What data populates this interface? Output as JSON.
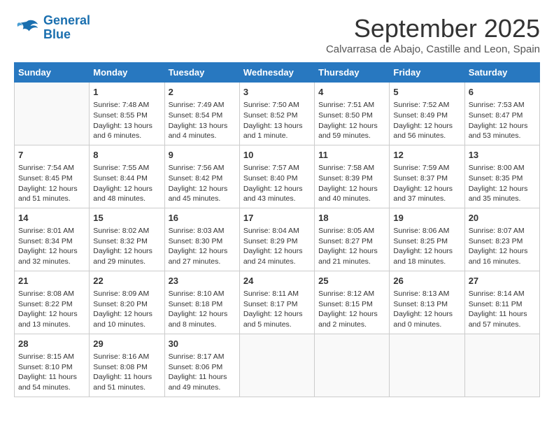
{
  "logo": {
    "line1": "General",
    "line2": "Blue"
  },
  "title": "September 2025",
  "subtitle": "Calvarrasa de Abajo, Castille and Leon, Spain",
  "weekdays": [
    "Sunday",
    "Monday",
    "Tuesday",
    "Wednesday",
    "Thursday",
    "Friday",
    "Saturday"
  ],
  "weeks": [
    [
      {
        "day": "",
        "info": ""
      },
      {
        "day": "1",
        "info": "Sunrise: 7:48 AM\nSunset: 8:55 PM\nDaylight: 13 hours\nand 6 minutes."
      },
      {
        "day": "2",
        "info": "Sunrise: 7:49 AM\nSunset: 8:54 PM\nDaylight: 13 hours\nand 4 minutes."
      },
      {
        "day": "3",
        "info": "Sunrise: 7:50 AM\nSunset: 8:52 PM\nDaylight: 13 hours\nand 1 minute."
      },
      {
        "day": "4",
        "info": "Sunrise: 7:51 AM\nSunset: 8:50 PM\nDaylight: 12 hours\nand 59 minutes."
      },
      {
        "day": "5",
        "info": "Sunrise: 7:52 AM\nSunset: 8:49 PM\nDaylight: 12 hours\nand 56 minutes."
      },
      {
        "day": "6",
        "info": "Sunrise: 7:53 AM\nSunset: 8:47 PM\nDaylight: 12 hours\nand 53 minutes."
      }
    ],
    [
      {
        "day": "7",
        "info": "Sunrise: 7:54 AM\nSunset: 8:45 PM\nDaylight: 12 hours\nand 51 minutes."
      },
      {
        "day": "8",
        "info": "Sunrise: 7:55 AM\nSunset: 8:44 PM\nDaylight: 12 hours\nand 48 minutes."
      },
      {
        "day": "9",
        "info": "Sunrise: 7:56 AM\nSunset: 8:42 PM\nDaylight: 12 hours\nand 45 minutes."
      },
      {
        "day": "10",
        "info": "Sunrise: 7:57 AM\nSunset: 8:40 PM\nDaylight: 12 hours\nand 43 minutes."
      },
      {
        "day": "11",
        "info": "Sunrise: 7:58 AM\nSunset: 8:39 PM\nDaylight: 12 hours\nand 40 minutes."
      },
      {
        "day": "12",
        "info": "Sunrise: 7:59 AM\nSunset: 8:37 PM\nDaylight: 12 hours\nand 37 minutes."
      },
      {
        "day": "13",
        "info": "Sunrise: 8:00 AM\nSunset: 8:35 PM\nDaylight: 12 hours\nand 35 minutes."
      }
    ],
    [
      {
        "day": "14",
        "info": "Sunrise: 8:01 AM\nSunset: 8:34 PM\nDaylight: 12 hours\nand 32 minutes."
      },
      {
        "day": "15",
        "info": "Sunrise: 8:02 AM\nSunset: 8:32 PM\nDaylight: 12 hours\nand 29 minutes."
      },
      {
        "day": "16",
        "info": "Sunrise: 8:03 AM\nSunset: 8:30 PM\nDaylight: 12 hours\nand 27 minutes."
      },
      {
        "day": "17",
        "info": "Sunrise: 8:04 AM\nSunset: 8:29 PM\nDaylight: 12 hours\nand 24 minutes."
      },
      {
        "day": "18",
        "info": "Sunrise: 8:05 AM\nSunset: 8:27 PM\nDaylight: 12 hours\nand 21 minutes."
      },
      {
        "day": "19",
        "info": "Sunrise: 8:06 AM\nSunset: 8:25 PM\nDaylight: 12 hours\nand 18 minutes."
      },
      {
        "day": "20",
        "info": "Sunrise: 8:07 AM\nSunset: 8:23 PM\nDaylight: 12 hours\nand 16 minutes."
      }
    ],
    [
      {
        "day": "21",
        "info": "Sunrise: 8:08 AM\nSunset: 8:22 PM\nDaylight: 12 hours\nand 13 minutes."
      },
      {
        "day": "22",
        "info": "Sunrise: 8:09 AM\nSunset: 8:20 PM\nDaylight: 12 hours\nand 10 minutes."
      },
      {
        "day": "23",
        "info": "Sunrise: 8:10 AM\nSunset: 8:18 PM\nDaylight: 12 hours\nand 8 minutes."
      },
      {
        "day": "24",
        "info": "Sunrise: 8:11 AM\nSunset: 8:17 PM\nDaylight: 12 hours\nand 5 minutes."
      },
      {
        "day": "25",
        "info": "Sunrise: 8:12 AM\nSunset: 8:15 PM\nDaylight: 12 hours\nand 2 minutes."
      },
      {
        "day": "26",
        "info": "Sunrise: 8:13 AM\nSunset: 8:13 PM\nDaylight: 12 hours\nand 0 minutes."
      },
      {
        "day": "27",
        "info": "Sunrise: 8:14 AM\nSunset: 8:11 PM\nDaylight: 11 hours\nand 57 minutes."
      }
    ],
    [
      {
        "day": "28",
        "info": "Sunrise: 8:15 AM\nSunset: 8:10 PM\nDaylight: 11 hours\nand 54 minutes."
      },
      {
        "day": "29",
        "info": "Sunrise: 8:16 AM\nSunset: 8:08 PM\nDaylight: 11 hours\nand 51 minutes."
      },
      {
        "day": "30",
        "info": "Sunrise: 8:17 AM\nSunset: 8:06 PM\nDaylight: 11 hours\nand 49 minutes."
      },
      {
        "day": "",
        "info": ""
      },
      {
        "day": "",
        "info": ""
      },
      {
        "day": "",
        "info": ""
      },
      {
        "day": "",
        "info": ""
      }
    ]
  ]
}
